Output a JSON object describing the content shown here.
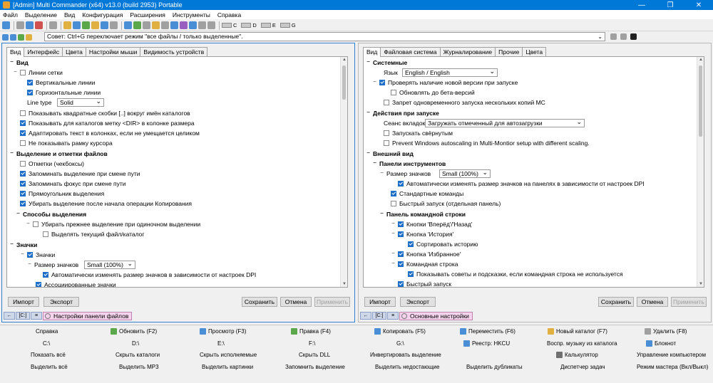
{
  "window": {
    "title": "[Admin] Multi Commander (x64)  v13.0 (build 2953) Portable"
  },
  "menu": [
    "Файл",
    "Выделение",
    "Вид",
    "Конфигурация",
    "Расширения",
    "Инструменты",
    "Справка"
  ],
  "toolbar": {
    "drives": [
      "C",
      "D",
      "E",
      "G"
    ]
  },
  "tipbar": {
    "text": "Совет: Ctrl+G переключает режим \"все файлы / только выделенные\"."
  },
  "left": {
    "tabs": [
      "Вид",
      "Интерфейс",
      "Цвета",
      "Настройки мыши",
      "Видимость устройств"
    ],
    "rows": [
      {
        "label": "Вид",
        "type": "header"
      },
      {
        "label": "Линии сетки",
        "checked": false
      },
      {
        "label": "Вертикальные линии",
        "checked": true
      },
      {
        "label": "Горизонтальные линии",
        "checked": true
      },
      {
        "label": "Line type",
        "type": "select",
        "value": "Solid"
      },
      {
        "label": "Показывать квадратные скобки [..] вокруг имён каталогов",
        "checked": false
      },
      {
        "label": "Показывать для каталогов метку <DIR> в колонке размера",
        "checked": true
      },
      {
        "label": "Адаптировать текст в колонках, если не умещается целиком",
        "checked": true
      },
      {
        "label": "Не показывать рамку курсора",
        "checked": false
      },
      {
        "label": "Выделение и отметки файлов",
        "type": "header"
      },
      {
        "label": "Отметки (чекбоксы)",
        "checked": false
      },
      {
        "label": "Запоминать выделение при смене пути",
        "checked": true
      },
      {
        "label": "Запоминать фокус при смене пути",
        "checked": true
      },
      {
        "label": "Прямоугольник выделения",
        "checked": true
      },
      {
        "label": "Убирать выделение после начала операции Копирования",
        "checked": true
      },
      {
        "label": "Способы выделения",
        "type": "header"
      },
      {
        "label": "Убирать прежнее выделение при одиночном выделении",
        "checked": false
      },
      {
        "label": "Выделять текущий файл/каталог",
        "checked": false
      },
      {
        "label": "Значки",
        "type": "header"
      },
      {
        "label": "Значки",
        "checked": true
      },
      {
        "label": "Размер значков",
        "type": "select",
        "value": "Small (100%)"
      },
      {
        "label": "Автоматически изменять размер значков в зависимости от настроек DPI",
        "checked": true
      },
      {
        "label": "Ассоциированные значки",
        "checked": true
      }
    ],
    "buttons": {
      "import": "Импорт",
      "export": "Экспорт",
      "save": "Сохранить",
      "cancel": "Отмена",
      "apply": "Применить"
    },
    "tab_label": "Настройки панели файлов",
    "strip": [
      "←",
      "[C:]"
    ]
  },
  "right": {
    "tabs": [
      "Вид",
      "Файловая система",
      "Журналирование",
      "Прочие",
      "Цвета"
    ],
    "rows": [
      {
        "label": "Системные",
        "type": "header"
      },
      {
        "label": "Язык",
        "type": "select",
        "value": "English / English"
      },
      {
        "label": "Проверять наличие новой версии при запуске",
        "checked": true
      },
      {
        "label": "Обновлять до бета-версий",
        "checked": false
      },
      {
        "label": "Запрет одновременного запуска нескольких копий MC",
        "checked": false
      },
      {
        "label": "Действия при запуске",
        "type": "header"
      },
      {
        "label": "Сеанс вкладок",
        "type": "select",
        "value": "Загружать отмеченный для автозагрузки"
      },
      {
        "label": "Запускать свёрнутым",
        "checked": false
      },
      {
        "label": "Prevent Windows autoscaling in Multi-Montior setup with different scaling.",
        "checked": false
      },
      {
        "label": "Внешний вид",
        "type": "header"
      },
      {
        "label": "Панели инструментов",
        "type": "header"
      },
      {
        "label": "Размер значков",
        "type": "select",
        "value": "Small (100%)"
      },
      {
        "label": "Автоматически изменять размер значков на панелях в зависимости от настроек DPI",
        "checked": true
      },
      {
        "label": "Стандартные команды",
        "checked": true
      },
      {
        "label": "Быстрый запуск (отдельная панель)",
        "checked": false
      },
      {
        "label": "Панель командной строки",
        "type": "header"
      },
      {
        "label": "Кнопки 'Вперёд'/'Назад'",
        "checked": true
      },
      {
        "label": "Кнопка 'История'",
        "checked": true
      },
      {
        "label": "Сортировать историю",
        "checked": true
      },
      {
        "label": "Кнопка 'Избранное'",
        "checked": true
      },
      {
        "label": "Командная строка",
        "checked": true
      },
      {
        "label": "Показывать советы и подсказки, если командная строка не используется",
        "checked": true
      },
      {
        "label": "Быстрый запуск",
        "checked": true
      }
    ],
    "buttons": {
      "import": "Импорт",
      "export": "Экспорт",
      "save": "Сохранить",
      "cancel": "Отмена",
      "apply": "Применить"
    },
    "tab_label": "Основные настройки",
    "strip": [
      "←",
      "[C:]"
    ]
  },
  "commands": [
    [
      "Справка",
      "Обновить (F2)",
      "Просмотр (F3)",
      "Правка (F4)",
      "Копировать (F5)",
      "Переместить (F6)",
      "Новый каталог (F7)",
      "Удалить (F8)"
    ],
    [
      "C:\\",
      "D:\\",
      "E:\\",
      "F:\\",
      "G:\\",
      "Реестр: HKCU",
      "Воспр. музыку из каталога",
      "Блокнот"
    ],
    [
      "Показать всё",
      "Скрыть каталоги",
      "Скрыть исполняемые",
      "Скрыть DLL",
      "Инвертировать выделение",
      "",
      "Калькулятор",
      "Управление компьютером"
    ],
    [
      "Выделить всё",
      "Выделить MP3",
      "Выделить картинки",
      "Запомнить выделение",
      "Выделить недостающие",
      "Выделить дубликаты",
      "Диспетчер задач",
      "Режим мастера (Вкл/Выкл)"
    ]
  ],
  "colors": {
    "titlebar": "#0078d7",
    "checkbox": "#1e6fc8",
    "active_border": "#2f80d0",
    "tab_pink": "#f4d4ec"
  }
}
